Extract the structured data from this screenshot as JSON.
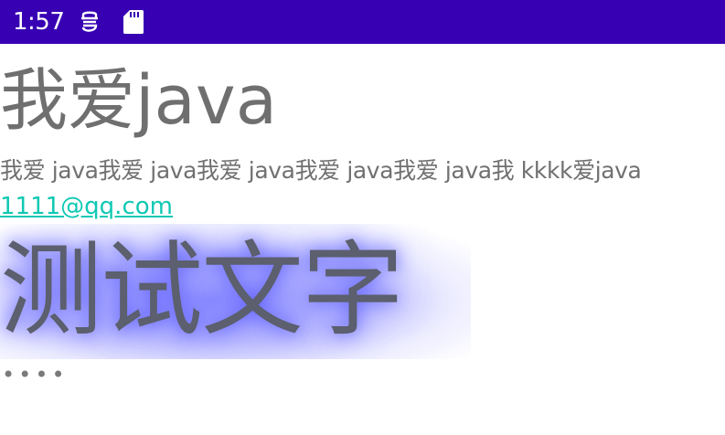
{
  "status_bar": {
    "time": "1:57",
    "icons": [
      "android-debug-icon",
      "sd-card-icon"
    ],
    "background_color": "#3700b3"
  },
  "content": {
    "title": "我爱java",
    "subtitle": "我爱 java我爱 java我爱 java我爱 java我爱 java我 kkkk爱java",
    "email_link": "1111@qq.com",
    "glow_text": "测试文字",
    "ellipsis": "••••"
  },
  "colors": {
    "link": "#10c8b4",
    "glow": "#6a6aff",
    "text": "#6f6f6f"
  }
}
